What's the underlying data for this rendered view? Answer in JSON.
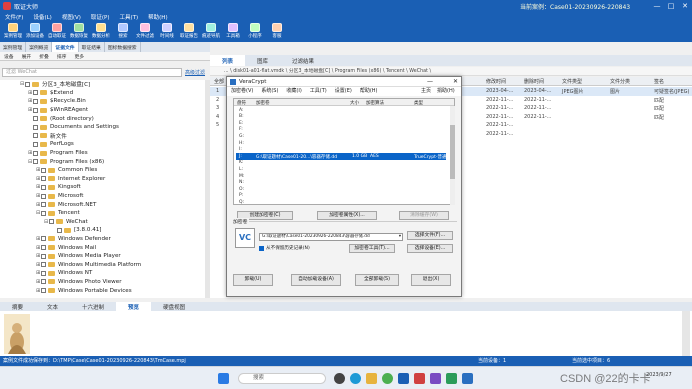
{
  "window": {
    "title": "取证大师",
    "case": "当前案例：Case01-20230926-220843",
    "controls": [
      "—",
      "□",
      "✕"
    ]
  },
  "menu": [
    "文件(F)",
    "设备(L)",
    "视图(V)",
    "取证(P)",
    "工具(T)",
    "帮助(H)"
  ],
  "toolbar": [
    "案例管理",
    "添加设备",
    "自动取证",
    "数据恢复",
    "数据分析",
    "搜索",
    "文件过滤",
    "时间线",
    "取证报告",
    "痕迹导航",
    "工具箱",
    "小程序",
    "客服"
  ],
  "left_tabs": [
    "案例管理",
    "案例概览",
    "证据文件",
    "取证结果",
    "图标数据搜索"
  ],
  "left_active_tab": 2,
  "left_tools": [
    "设备",
    "展开",
    "折叠",
    "排序",
    "更多"
  ],
  "search": {
    "placeholder": "过滤 WeChat",
    "filter_link": "高级过滤"
  },
  "tree": [
    {
      "label": "分区3_本地磁盘[C]",
      "indent": 0,
      "exp": "⊟"
    },
    {
      "label": "$Extend",
      "indent": 1,
      "exp": "⊞"
    },
    {
      "label": "$Recycle.Bin",
      "indent": 1,
      "exp": "⊞"
    },
    {
      "label": "$WinREAgent",
      "indent": 1,
      "exp": "⊞"
    },
    {
      "label": "(Root directory)",
      "indent": 1,
      "exp": ""
    },
    {
      "label": "Documents and Settings",
      "indent": 1,
      "exp": ""
    },
    {
      "label": "新文件",
      "indent": 1,
      "exp": ""
    },
    {
      "label": "PerfLogs",
      "indent": 1,
      "exp": ""
    },
    {
      "label": "Program Files",
      "indent": 1,
      "exp": "⊞"
    },
    {
      "label": "Program Files (x86)",
      "indent": 1,
      "exp": "⊟"
    },
    {
      "label": "Common Files",
      "indent": 2,
      "exp": "⊞"
    },
    {
      "label": "Internet Explorer",
      "indent": 2,
      "exp": "⊞"
    },
    {
      "label": "Kingsoft",
      "indent": 2,
      "exp": "⊞"
    },
    {
      "label": "Microsoft",
      "indent": 2,
      "exp": "⊞"
    },
    {
      "label": "Microsoft.NET",
      "indent": 2,
      "exp": "⊞"
    },
    {
      "label": "Tencent",
      "indent": 2,
      "exp": "⊟"
    },
    {
      "label": "WeChat",
      "indent": 3,
      "exp": "⊟"
    },
    {
      "label": "[3.8.0.41]",
      "indent": 4,
      "exp": ""
    },
    {
      "label": "Windows Defender",
      "indent": 2,
      "exp": "⊞"
    },
    {
      "label": "Windows Mail",
      "indent": 2,
      "exp": "⊞"
    },
    {
      "label": "Windows Media Player",
      "indent": 2,
      "exp": "⊞"
    },
    {
      "label": "Windows Multimedia Platform",
      "indent": 2,
      "exp": "⊞"
    },
    {
      "label": "Windows NT",
      "indent": 2,
      "exp": "⊞"
    },
    {
      "label": "Windows Photo Viewer",
      "indent": 2,
      "exp": "⊞"
    },
    {
      "label": "Windows Portable Devices",
      "indent": 2,
      "exp": "⊞"
    }
  ],
  "right_tabs": [
    "列表",
    "图库",
    "过滤结果"
  ],
  "breadcrumb": "... \\ disk01-a01-flat.vmdk \\ 分区3_本地磁盘[C] \\ Program Files (x86) \\ Tencent \\ WeChat \\",
  "grid": {
    "head_prefix": "全部",
    "columns": [
      "修改时间",
      "删除时间",
      "文件类型",
      "文件分类",
      "签名"
    ],
    "rows": [
      {
        "n": "1",
        "mod": "2023-04-...",
        "del": "2023-04-...",
        "type": "JPEG图片",
        "cat": "图片",
        "sig": "可疑签名(JPEG)"
      },
      {
        "n": "2",
        "mod": "2022-11-...",
        "del": "2022-11-...",
        "type": "",
        "cat": "",
        "sig": "匹配"
      },
      {
        "n": "3",
        "mod": "2022-11-...",
        "del": "2022-11-...",
        "type": "",
        "cat": "",
        "sig": "匹配"
      },
      {
        "n": "4",
        "mod": "2022-11-...",
        "del": "2022-11-...",
        "type": "",
        "cat": "",
        "sig": "匹配"
      },
      {
        "n": "5",
        "mod": "2022-11-...",
        "del": "",
        "type": "",
        "cat": "",
        "sig": ""
      },
      {
        "n": "",
        "mod": "2022-11-...",
        "del": "",
        "type": "",
        "cat": "",
        "sig": ""
      }
    ]
  },
  "bottom_tabs": [
    "摘要",
    "文本",
    "十六进制",
    "预览",
    "硬盘视图"
  ],
  "bottom_active_tab": 3,
  "status": {
    "left": "案例文件成功保存到：D:\\TMP\\Case\\Case01-20230926-220843\\TmCase.mpj",
    "mid": "当前设备：1",
    "count": "当前选中项目：6"
  },
  "taskbar": {
    "search_placeholder": "搜索",
    "date": "2023/9/27"
  },
  "watermark": "CSDN @22的卡卡",
  "dialog": {
    "title": "VeraCrypt",
    "menu": [
      "加密卷(V)",
      "系统(S)",
      "收藏(I)",
      "工具(T)",
      "设置(E)",
      "帮助(H)"
    ],
    "menu_right": [
      "主页",
      "捐助(H)"
    ],
    "list_headers": [
      "盘符",
      "加密卷",
      "大小",
      "加密算法",
      "类型"
    ],
    "drives": [
      {
        "letter": "A:"
      },
      {
        "letter": "B:"
      },
      {
        "letter": "E:"
      },
      {
        "letter": "F:"
      },
      {
        "letter": "G:"
      },
      {
        "letter": "H:"
      },
      {
        "letter": "I:"
      },
      {
        "letter": "J:",
        "path": "G:\\取证题材\\Case01-20...\\容器存储.dd",
        "size": "1.0 GB",
        "algo": "AES",
        "type": "TrueCrypt-普通",
        "selected": true
      },
      {
        "letter": "K:"
      },
      {
        "letter": "L:"
      },
      {
        "letter": "M:"
      },
      {
        "letter": "N:"
      },
      {
        "letter": "O:"
      },
      {
        "letter": "P:"
      },
      {
        "letter": "Q:"
      }
    ],
    "buttons": {
      "create": "创建加密卷(C)",
      "props": "加密卷属性(X)...",
      "wipe": "清除缓存(W)",
      "file": "选择文件(F)...",
      "tools": "加密卷工具(T)...",
      "device": "选择设备(E)...",
      "unmount": "卸载(U)",
      "automount": "自动加载设备(A)",
      "unmount_all": "全部卸载(S)",
      "exit": "退出(X)"
    },
    "volume_label": "加密卷",
    "volume_path": "G:\\取证题材\\Case01-20230926-220843\\容器存储.dd",
    "never_save": "从不保留历史记录(N)"
  },
  "colors": {
    "brand": "#1a5fb4",
    "selection": "#0a64c8"
  }
}
